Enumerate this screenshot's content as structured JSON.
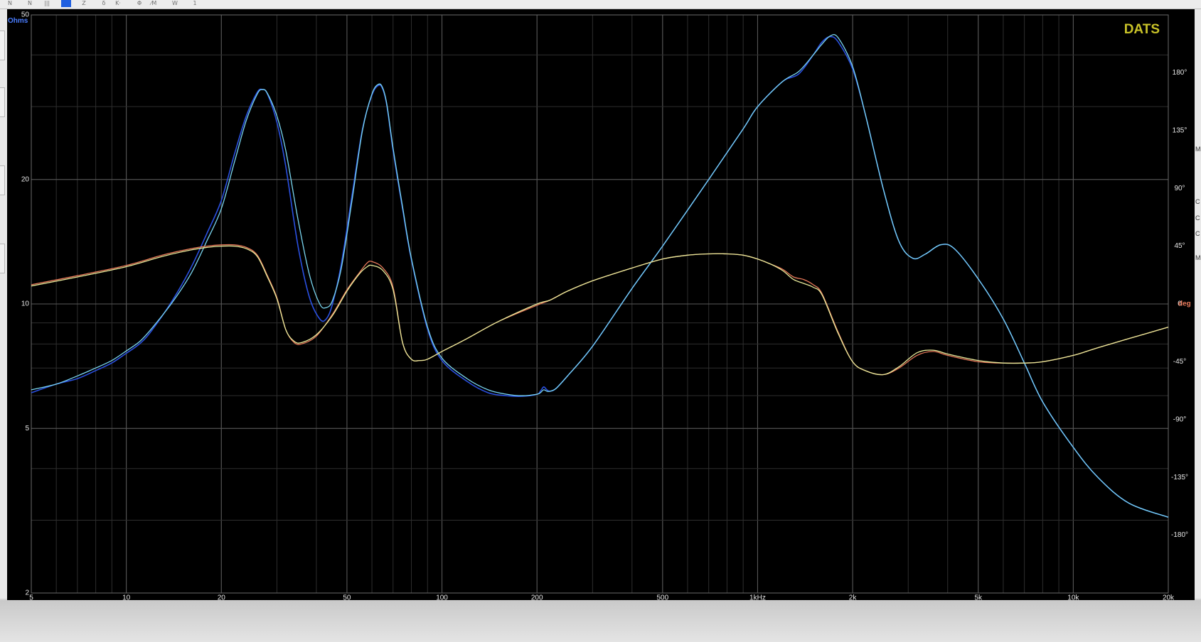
{
  "toolbar": {
    "buttons": [
      {
        "icon": "nav-first-icon",
        "glyph": "N"
      },
      {
        "icon": "nav-prev-icon",
        "glyph": "N"
      },
      {
        "icon": "grid-icon",
        "glyph": "|||"
      },
      {
        "icon": "color-block-icon",
        "glyph": ""
      },
      {
        "icon": "zoom-icon",
        "glyph": "Z"
      },
      {
        "icon": "link-icon",
        "glyph": "δ"
      },
      {
        "icon": "cursor-icon",
        "glyph": "K·"
      },
      {
        "icon": "phase-icon",
        "glyph": "Φ"
      },
      {
        "icon": "smooth-icon",
        "glyph": "⁄M"
      },
      {
        "icon": "wave-icon",
        "glyph": "W"
      },
      {
        "icon": "channel-1-icon",
        "glyph": "1"
      }
    ]
  },
  "right_strip_letters": [
    "M",
    "C",
    "C",
    "C",
    "M"
  ],
  "colors": {
    "background": "#000000",
    "grid_major": "#5a5a5a",
    "grid_minor": "#2e2e2e",
    "impedance_blue": "#2a50e0",
    "impedance_cyan": "#7ad6f0",
    "phase_yellow": "#e8ea9a",
    "phase_orange": "#e8795a",
    "brand": "#c8c228",
    "axis_text": "#e6e6e6",
    "ohms_label": "#4a7dff",
    "deg_label": "#e8795a"
  },
  "chart_data": {
    "type": "line",
    "title": "",
    "brand_label": "DATS",
    "xscale": "log",
    "xlim": [
      5,
      20000
    ],
    "x_tick_values": [
      5,
      10,
      20,
      50,
      100,
      200,
      500,
      1000,
      2000,
      5000,
      10000,
      20000
    ],
    "x_tick_labels": [
      "5",
      "10",
      "20",
      "50",
      "100",
      "200",
      "500",
      "1kHz",
      "2k",
      "5k",
      "10k",
      "20k"
    ],
    "y_left": {
      "label": "Ohms",
      "scale": "log",
      "lim": [
        2,
        50
      ],
      "tick_values": [
        50,
        20,
        10,
        5,
        2
      ],
      "tick_labels": [
        "50",
        "20",
        "10",
        "5",
        "2"
      ]
    },
    "y_right": {
      "label": "deg",
      "lim": [
        -225,
        225
      ],
      "tick_values": [
        180,
        135,
        90,
        45,
        0,
        -45,
        -90,
        -135,
        -180
      ],
      "tick_labels": [
        "180°",
        "135°",
        "90°",
        "45°",
        "0",
        "-45°",
        "-90°",
        "-135°",
        "-180°"
      ]
    },
    "grid": true,
    "series": [
      {
        "axis": "left",
        "color_key": "impedance_blue",
        "width": 1.6,
        "x": [
          5,
          6,
          7,
          8,
          9,
          10,
          11,
          12,
          14,
          16,
          18,
          20,
          22,
          24,
          26,
          27,
          28,
          30,
          32,
          35,
          38,
          41,
          43,
          45,
          48,
          52,
          56,
          60,
          63,
          65,
          67,
          70,
          75,
          80,
          90,
          100,
          120,
          140,
          160,
          180,
          200,
          205,
          210,
          215,
          220,
          230,
          250,
          300,
          400,
          500,
          700,
          900,
          1000,
          1200,
          1350,
          1500,
          1600,
          1700,
          1800,
          2000,
          2200,
          2500,
          2800,
          3100,
          3400,
          3800,
          4200,
          5000,
          6000,
          7000,
          8000,
          10000,
          12000,
          15000,
          20000
        ],
        "y": [
          6.1,
          6.4,
          6.6,
          6.9,
          7.2,
          7.6,
          8.0,
          8.6,
          10.2,
          12.2,
          14.8,
          17.8,
          23.0,
          28.5,
          32.5,
          33.0,
          32.2,
          27.5,
          21.5,
          13.8,
          10.4,
          9.2,
          9.2,
          10.0,
          12.5,
          18.5,
          26.5,
          32.0,
          33.8,
          33.0,
          30.0,
          23.5,
          17.0,
          12.8,
          8.7,
          7.3,
          6.5,
          6.1,
          6.0,
          5.98,
          6.05,
          6.15,
          6.3,
          6.2,
          6.15,
          6.25,
          6.7,
          7.9,
          10.9,
          13.8,
          20.0,
          26.5,
          30.0,
          34.5,
          36.0,
          40.0,
          43.0,
          44.3,
          43.0,
          37.0,
          28.5,
          19.0,
          14.2,
          12.9,
          13.2,
          13.9,
          13.6,
          11.5,
          9.2,
          7.2,
          5.8,
          4.5,
          3.8,
          3.3,
          3.05
        ]
      },
      {
        "axis": "left",
        "color_key": "impedance_cyan",
        "width": 1.3,
        "x": [
          5,
          6,
          7,
          8,
          9,
          10,
          11,
          12,
          14,
          16,
          18,
          20,
          22,
          24,
          26,
          27,
          28,
          30,
          32,
          35,
          38,
          41,
          43,
          45,
          48,
          52,
          56,
          60,
          63,
          65,
          67,
          70,
          75,
          80,
          90,
          100,
          120,
          140,
          160,
          180,
          200,
          205,
          210,
          215,
          220,
          230,
          250,
          300,
          400,
          500,
          700,
          900,
          1000,
          1200,
          1350,
          1500,
          1600,
          1700,
          1800,
          2000,
          2200,
          2500,
          2800,
          3100,
          3400,
          3800,
          4200,
          5000,
          6000,
          7000,
          8000,
          10000,
          12000,
          15000,
          20000
        ],
        "y": [
          6.2,
          6.4,
          6.7,
          7.0,
          7.3,
          7.7,
          8.1,
          8.7,
          10.1,
          11.8,
          14.2,
          17.0,
          22.0,
          27.8,
          32.2,
          33.0,
          32.3,
          28.5,
          23.5,
          16.0,
          11.8,
          10.0,
          9.8,
          10.2,
          12.2,
          18.0,
          26.3,
          32.2,
          34.0,
          33.2,
          30.2,
          23.8,
          17.2,
          12.9,
          8.8,
          7.4,
          6.6,
          6.2,
          6.05,
          6.0,
          6.05,
          6.1,
          6.2,
          6.15,
          6.15,
          6.25,
          6.7,
          7.9,
          10.9,
          13.8,
          20.0,
          26.5,
          30.0,
          34.5,
          36.5,
          40.0,
          42.5,
          44.5,
          44.0,
          37.5,
          28.5,
          19.0,
          14.2,
          12.9,
          13.2,
          13.9,
          13.6,
          11.5,
          9.2,
          7.2,
          5.8,
          4.5,
          3.8,
          3.3,
          3.05
        ]
      },
      {
        "axis": "right",
        "color_key": "phase_orange",
        "width": 1.3,
        "x": [
          5,
          7,
          10,
          13,
          16,
          18,
          20,
          22,
          24,
          26,
          28,
          30,
          32,
          34,
          36,
          40,
          45,
          50,
          55,
          58,
          60,
          65,
          70,
          75,
          80,
          85,
          90,
          100,
          120,
          150,
          200,
          220,
          250,
          300,
          400,
          500,
          600,
          700,
          800,
          900,
          1000,
          1100,
          1200,
          1300,
          1400,
          1500,
          1600,
          1800,
          2000,
          2200,
          2500,
          2800,
          3200,
          3600,
          4000,
          5000,
          6000,
          7000,
          8000,
          10000,
          12000,
          15000,
          20000
        ],
        "y": [
          15,
          22,
          30,
          38,
          43,
          45,
          46,
          46,
          44,
          38,
          22,
          5,
          -20,
          -30,
          -31,
          -25,
          -8,
          11,
          25,
          32,
          33,
          28,
          13,
          -30,
          -43,
          -44,
          -43,
          -37,
          -27,
          -14,
          -1,
          3,
          10,
          18,
          28,
          35,
          38,
          39,
          39,
          38,
          35,
          31,
          27,
          21,
          19,
          15,
          8,
          -22,
          -45,
          -52,
          -55,
          -50,
          -40,
          -37,
          -40,
          -45,
          -46,
          -46,
          -45,
          -40,
          -34,
          -27,
          -18
        ]
      },
      {
        "axis": "right",
        "color_key": "phase_yellow",
        "width": 1.3,
        "x": [
          5,
          7,
          10,
          13,
          16,
          18,
          20,
          22,
          24,
          26,
          28,
          30,
          32,
          34,
          36,
          40,
          45,
          50,
          55,
          58,
          60,
          65,
          70,
          75,
          80,
          85,
          90,
          100,
          120,
          150,
          200,
          220,
          250,
          300,
          400,
          500,
          600,
          700,
          800,
          900,
          1000,
          1100,
          1200,
          1300,
          1400,
          1500,
          1600,
          1800,
          2000,
          2200,
          2500,
          2800,
          3200,
          3600,
          4000,
          5000,
          6000,
          7000,
          8000,
          10000,
          12000,
          15000,
          20000
        ],
        "y": [
          14,
          21,
          29,
          37,
          42,
          44,
          45,
          45,
          43,
          37,
          21,
          4,
          -20,
          -29,
          -30,
          -24,
          -9,
          10,
          24,
          29,
          30,
          26,
          11,
          -30,
          -43,
          -44,
          -43,
          -37,
          -27,
          -14,
          0,
          3,
          10,
          18,
          28,
          35,
          38,
          39,
          39,
          38,
          35,
          31,
          26,
          19,
          16,
          13,
          7,
          -23,
          -45,
          -52,
          -55,
          -49,
          -38,
          -36,
          -39,
          -44,
          -46,
          -46,
          -45,
          -40,
          -34,
          -27,
          -18
        ]
      }
    ]
  }
}
